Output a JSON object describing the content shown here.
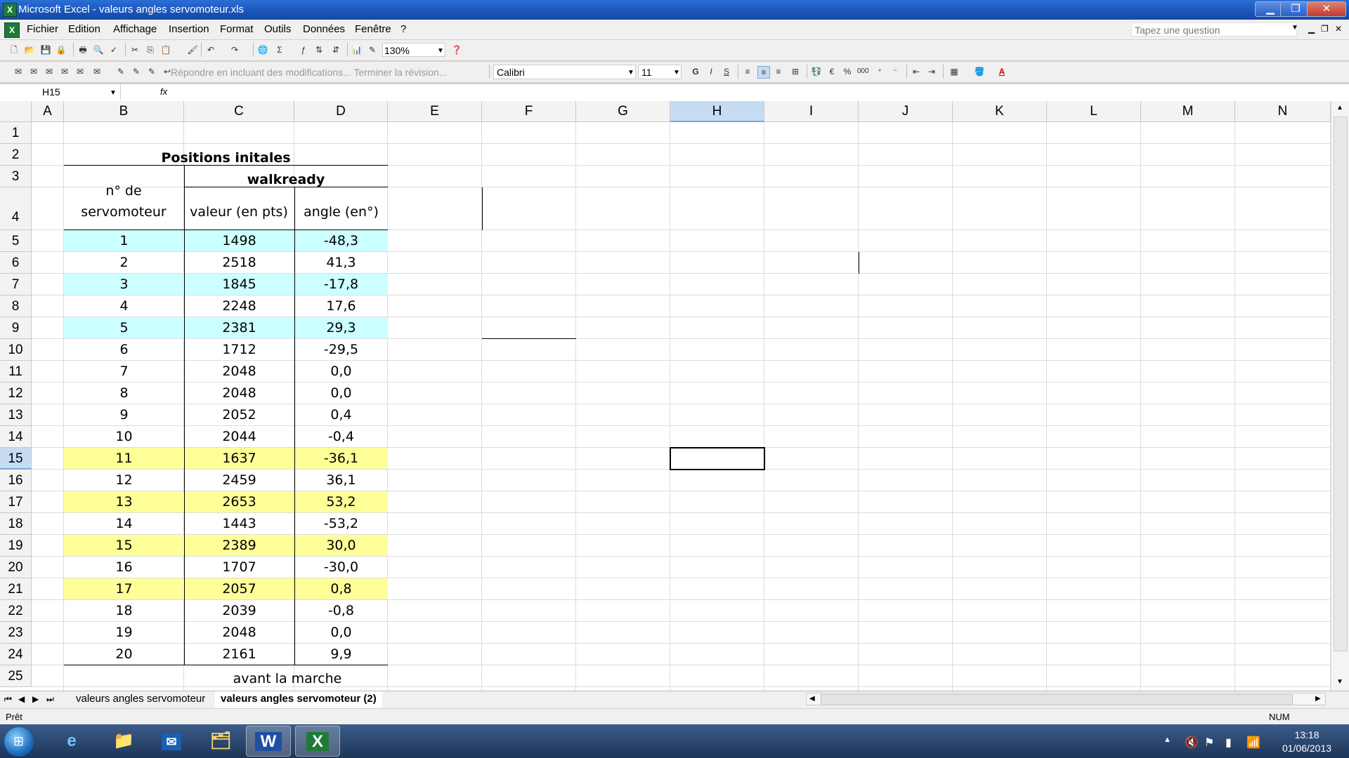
{
  "window": {
    "title": "Microsoft Excel - valeurs angles servomoteur.xls",
    "app_icon": "excel-icon",
    "controls": [
      "minimize-icon",
      "maximize-icon",
      "close-icon"
    ]
  },
  "menu": {
    "items": [
      "Fichier",
      "Edition",
      "Affichage",
      "Insertion",
      "Format",
      "Outils",
      "Données",
      "Fenêtre",
      "?"
    ],
    "ask_placeholder": "Tapez une question"
  },
  "toolbar": {
    "zoom": "130%",
    "reply_text": "Répondre en incluant des modifications...",
    "end_review_text": "Terminer la révision...",
    "font_name": "Calibri",
    "font_size": "11",
    "bold": "G",
    "italic": "I",
    "underline": "S",
    "sigma": "Σ",
    "euro": "€",
    "percent": "%",
    "thousands": "000",
    "font_color_letter": "A"
  },
  "formula_bar": {
    "name_box": "H15",
    "fx": "fx",
    "content": ""
  },
  "columns": [
    "A",
    "B",
    "C",
    "D",
    "E",
    "F",
    "G",
    "H",
    "I",
    "J",
    "K",
    "L",
    "M",
    "N"
  ],
  "rows": [
    "1",
    "2",
    "3",
    "4",
    "5",
    "6",
    "7",
    "8",
    "9",
    "10",
    "11",
    "12",
    "13",
    "14",
    "15",
    "16",
    "17",
    "18",
    "19",
    "20",
    "21",
    "22",
    "23",
    "24",
    "25"
  ],
  "selected": {
    "column": "H",
    "row": "15",
    "cell": "H15"
  },
  "table": {
    "title": "Positions initales",
    "group_header": "walkready",
    "header_servo": "n° de servomoteur",
    "header_value": "valeur (en pts)",
    "header_angle": "angle (en°)",
    "footer": "avant la marche",
    "rows": [
      {
        "servo": "1",
        "value": "1498",
        "angle": "-48,3",
        "fill": "#ccffff"
      },
      {
        "servo": "2",
        "value": "2518",
        "angle": "41,3",
        "fill": ""
      },
      {
        "servo": "3",
        "value": "1845",
        "angle": "-17,8",
        "fill": "#ccffff"
      },
      {
        "servo": "4",
        "value": "2248",
        "angle": "17,6",
        "fill": ""
      },
      {
        "servo": "5",
        "value": "2381",
        "angle": "29,3",
        "fill": "#ccffff"
      },
      {
        "servo": "6",
        "value": "1712",
        "angle": "-29,5",
        "fill": ""
      },
      {
        "servo": "7",
        "value": "2048",
        "angle": "0,0",
        "fill": ""
      },
      {
        "servo": "8",
        "value": "2048",
        "angle": "0,0",
        "fill": ""
      },
      {
        "servo": "9",
        "value": "2052",
        "angle": "0,4",
        "fill": ""
      },
      {
        "servo": "10",
        "value": "2044",
        "angle": "-0,4",
        "fill": ""
      },
      {
        "servo": "11",
        "value": "1637",
        "angle": "-36,1",
        "fill": "#ffff99"
      },
      {
        "servo": "12",
        "value": "2459",
        "angle": "36,1",
        "fill": ""
      },
      {
        "servo": "13",
        "value": "2653",
        "angle": "53,2",
        "fill": "#ffff99"
      },
      {
        "servo": "14",
        "value": "1443",
        "angle": "-53,2",
        "fill": ""
      },
      {
        "servo": "15",
        "value": "2389",
        "angle": "30,0",
        "fill": "#ffff99"
      },
      {
        "servo": "16",
        "value": "1707",
        "angle": "-30,0",
        "fill": ""
      },
      {
        "servo": "17",
        "value": "2057",
        "angle": "0,8",
        "fill": "#ffff99"
      },
      {
        "servo": "18",
        "value": "2039",
        "angle": "-0,8",
        "fill": ""
      },
      {
        "servo": "19",
        "value": "2048",
        "angle": "0,0",
        "fill": ""
      },
      {
        "servo": "20",
        "value": "2161",
        "angle": "9,9",
        "fill": ""
      }
    ]
  },
  "sheet_tabs": [
    {
      "label": "valeurs angles servomoteur",
      "active": false
    },
    {
      "label": "valeurs angles servomoteur (2)",
      "active": true
    }
  ],
  "status": {
    "left": "Prêt",
    "right": "NUM"
  },
  "taskbar": {
    "apps": [
      "ie-icon",
      "folder-icon",
      "outlook-icon",
      "explorer-icon",
      "word-icon",
      "excel-icon"
    ],
    "time": "13:18",
    "date": "01/06/2013"
  },
  "colors": {
    "cyan_fill": "#ccffff",
    "yellow_fill": "#ffff99",
    "header_selected": "#c6dcf3"
  }
}
